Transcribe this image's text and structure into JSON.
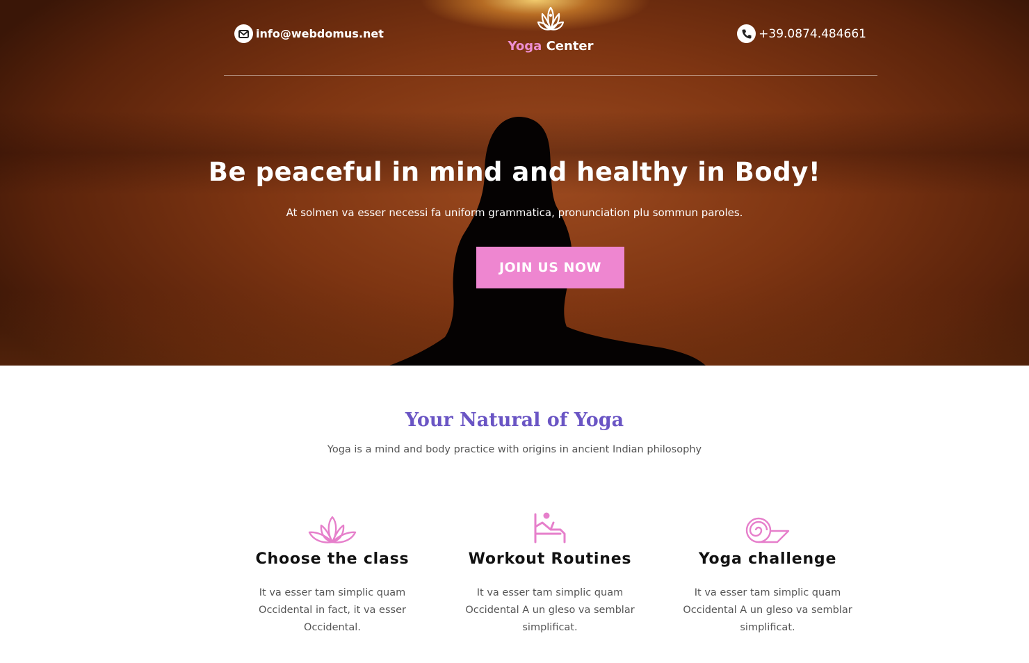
{
  "header": {
    "email": "info@webdomus.net",
    "phone": "+39.0874.484661",
    "logo": {
      "word1": "Yoga",
      "word2": "Center"
    }
  },
  "hero": {
    "title": "Be peaceful in mind and healthy in Body!",
    "subtitle": "At solmen va esser necessi fa uniform grammatica, pronunciation plu sommun paroles.",
    "cta_label": "JOIN US NOW"
  },
  "intro": {
    "title": "Your Natural of Yoga",
    "subtitle": "Yoga is a mind and body practice with origins in ancient Indian philosophy"
  },
  "features": [
    {
      "icon": "lotus-icon",
      "title": "Choose the class",
      "text": "It va esser tam simplic quam Occidental in fact, it va esser Occidental."
    },
    {
      "icon": "workout-icon",
      "title": "Workout Routines",
      "text": "It va esser tam simplic quam Occidental A un gleso va semblar simplificat."
    },
    {
      "icon": "yoga-mat-icon",
      "title": "Yoga challenge",
      "text": "It va esser tam simplic quam Occidental A un gleso va semblar simplificat."
    }
  ],
  "colors": {
    "accent_pink": "#ee86d0",
    "heading_purple": "#6a55c4",
    "hero_bg": "#7e3512"
  }
}
